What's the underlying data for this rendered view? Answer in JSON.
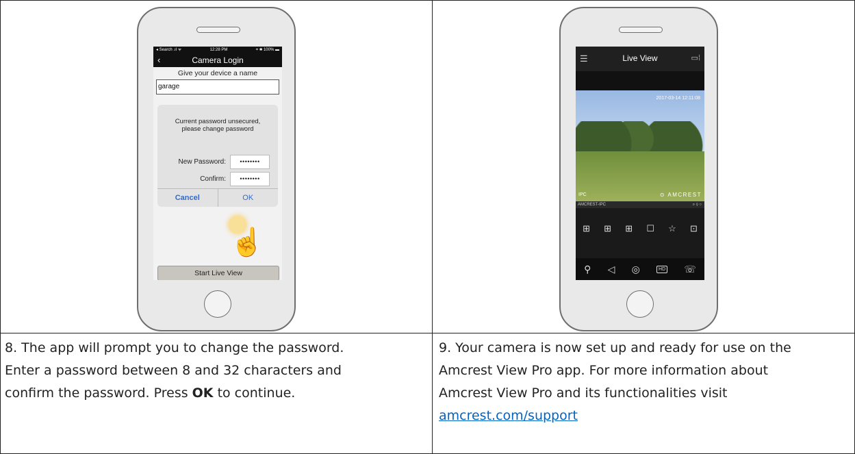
{
  "left_phone": {
    "status": {
      "carrier": "◂ Search .ıl ᯤ",
      "time": "12:28 PM",
      "battery": "⌖ ✱ 100% ▬"
    },
    "nav_title": "Camera Login",
    "name_label": "Give your device a name",
    "name_value": "garage",
    "dialog_msg_line1": "Current password unsecured,",
    "dialog_msg_line2": "please change password",
    "new_password_label": "New Password:",
    "confirm_label": "Confirm:",
    "new_password_value": "••••••••",
    "confirm_value": "••••••••",
    "cancel_label": "Cancel",
    "ok_label": "OK",
    "start_live_view_label": "Start Live View"
  },
  "right_phone": {
    "title": "Live View",
    "timestamp": "2017-03-14 12:11:08",
    "ipc_label": "IPC",
    "brand_text": "AMCREST",
    "cam_label": "AMCREST-IPC",
    "cam_icons": "⌕ ⚲ ○"
  },
  "left_caption": {
    "line1": "8. The app will prompt you to change the password.",
    "line2": "Enter a password between 8 and 32 characters and",
    "line3_pre": "confirm the password. Press ",
    "line3_bold": "OK",
    "line3_post": " to continue."
  },
  "right_caption": {
    "line1": "9. Your camera is now set up and ready for use on the",
    "line2": "Amcrest View Pro app.  For more information about",
    "line3": "Amcrest View Pro and its functionalities visit",
    "link": "amcrest.com/support"
  }
}
